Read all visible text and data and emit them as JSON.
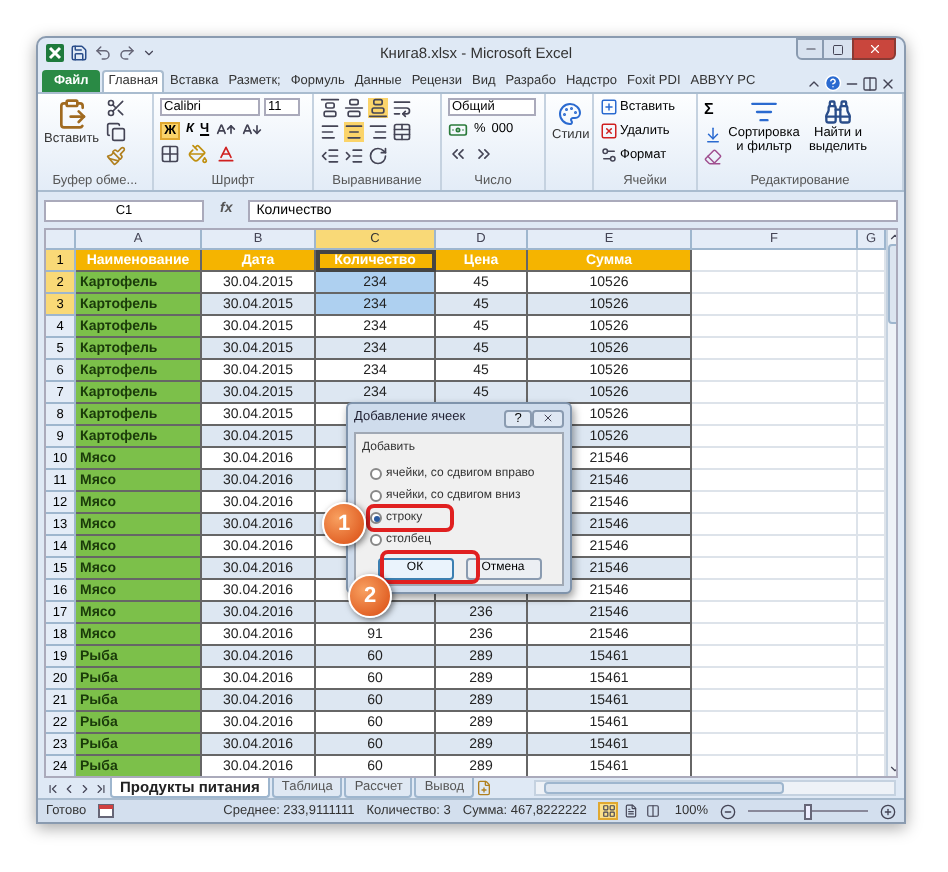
{
  "window": {
    "title": "Книга8.xlsx - Microsoft Excel"
  },
  "ribbon_tabs": [
    {
      "label": "Файл",
      "kind": "file",
      "selected": false
    },
    {
      "label": "Главная",
      "kind": "tab",
      "selected": true
    },
    {
      "label": "Вставка",
      "kind": "tab",
      "selected": false
    },
    {
      "label": "Разметк;",
      "kind": "tab",
      "selected": false
    },
    {
      "label": "Формуль",
      "kind": "tab",
      "selected": false
    },
    {
      "label": "Данные",
      "kind": "tab",
      "selected": false
    },
    {
      "label": "Рецензи",
      "kind": "tab",
      "selected": false
    },
    {
      "label": "Вид",
      "kind": "tab",
      "selected": false
    },
    {
      "label": "Разрабо",
      "kind": "tab",
      "selected": false
    },
    {
      "label": "Надстро",
      "kind": "tab",
      "selected": false
    },
    {
      "label": "Foxit PDI",
      "kind": "tab",
      "selected": false
    },
    {
      "label": "ABBYY PC",
      "kind": "tab",
      "selected": false
    }
  ],
  "ribbon": {
    "clipboard": {
      "paste": "Вставить",
      "label": "Буфер обме..."
    },
    "font": {
      "name": "Calibri",
      "size": "11",
      "bold": "Ж",
      "italic": "К",
      "underline": "Ч",
      "label": "Шрифт"
    },
    "alignment": {
      "label": "Выравнивание"
    },
    "number": {
      "format": "Общий",
      "percent": "%",
      "thousands": "000",
      "label": "Число"
    },
    "styles": {
      "button": "Стили"
    },
    "cells": {
      "insert": "Вставить",
      "delete": "Удалить",
      "format": "Формат",
      "label": "Ячейки"
    },
    "editing": {
      "sum": "Σ",
      "sort": "Сортировка и фильтр",
      "find": "Найти и выделить",
      "label": "Редактирование"
    }
  },
  "formula_bar": {
    "name_box": "C1",
    "fx": "fx",
    "value": "Количество"
  },
  "columns": [
    {
      "label": "A",
      "selected": false
    },
    {
      "label": "B",
      "selected": false
    },
    {
      "label": "C",
      "selected": true
    },
    {
      "label": "D",
      "selected": false
    },
    {
      "label": "E",
      "selected": false
    },
    {
      "label": "F",
      "selected": false
    },
    {
      "label": "G",
      "selected": false
    }
  ],
  "rows": [
    {
      "number": "1",
      "kind": "header",
      "selected": true,
      "cells": [
        "Наименование",
        "Дата",
        "Количество",
        "Цена",
        "Сумма"
      ]
    },
    {
      "number": "2",
      "kind": "data",
      "selected": true,
      "cells": [
        "Картофель",
        "30.04.2015",
        "234",
        "45",
        "10526"
      ]
    },
    {
      "number": "3",
      "kind": "data",
      "selected": true,
      "cells": [
        "Картофель",
        "30.04.2015",
        "234",
        "45",
        "10526"
      ]
    },
    {
      "number": "4",
      "kind": "data",
      "selected": false,
      "cells": [
        "Картофель",
        "30.04.2015",
        "234",
        "45",
        "10526"
      ]
    },
    {
      "number": "5",
      "kind": "data",
      "selected": false,
      "cells": [
        "Картофель",
        "30.04.2015",
        "234",
        "45",
        "10526"
      ]
    },
    {
      "number": "6",
      "kind": "data",
      "selected": false,
      "cells": [
        "Картофель",
        "30.04.2015",
        "234",
        "45",
        "10526"
      ]
    },
    {
      "number": "7",
      "kind": "data",
      "selected": false,
      "cells": [
        "Картофель",
        "30.04.2015",
        "234",
        "45",
        "10526"
      ]
    },
    {
      "number": "8",
      "kind": "data",
      "selected": false,
      "cells": [
        "Картофель",
        "30.04.2015",
        null,
        null,
        "10526"
      ]
    },
    {
      "number": "9",
      "kind": "data",
      "selected": false,
      "cells": [
        "Картофель",
        "30.04.2015",
        null,
        null,
        "10526"
      ]
    },
    {
      "number": "10",
      "kind": "data",
      "selected": false,
      "cells": [
        "Мясо",
        "30.04.2016",
        null,
        null,
        "21546"
      ]
    },
    {
      "number": "11",
      "kind": "data",
      "selected": false,
      "cells": [
        "Мясо",
        "30.04.2016",
        null,
        null,
        "21546"
      ]
    },
    {
      "number": "12",
      "kind": "data",
      "selected": false,
      "cells": [
        "Мясо",
        "30.04.2016",
        null,
        null,
        "21546"
      ]
    },
    {
      "number": "13",
      "kind": "data",
      "selected": false,
      "cells": [
        "Мясо",
        "30.04.2016",
        null,
        null,
        "21546"
      ]
    },
    {
      "number": "14",
      "kind": "data",
      "selected": false,
      "cells": [
        "Мясо",
        "30.04.2016",
        null,
        null,
        "21546"
      ]
    },
    {
      "number": "15",
      "kind": "data",
      "selected": false,
      "cells": [
        "Мясо",
        "30.04.2016",
        null,
        null,
        "21546"
      ]
    },
    {
      "number": "16",
      "kind": "data",
      "selected": false,
      "cells": [
        "Мясо",
        "30.04.2016",
        null,
        null,
        "21546"
      ]
    },
    {
      "number": "17",
      "kind": "data",
      "selected": false,
      "cells": [
        "Мясо",
        "30.04.2016",
        null,
        "236",
        "21546"
      ]
    },
    {
      "number": "18",
      "kind": "data",
      "selected": false,
      "cells": [
        "Мясо",
        "30.04.2016",
        "91",
        "236",
        "21546"
      ]
    },
    {
      "number": "19",
      "kind": "data",
      "selected": false,
      "cells": [
        "Рыба",
        "30.04.2016",
        "60",
        "289",
        "15461"
      ]
    },
    {
      "number": "20",
      "kind": "data",
      "selected": false,
      "cells": [
        "Рыба",
        "30.04.2016",
        "60",
        "289",
        "15461"
      ]
    },
    {
      "number": "21",
      "kind": "data",
      "selected": false,
      "cells": [
        "Рыба",
        "30.04.2016",
        "60",
        "289",
        "15461"
      ]
    },
    {
      "number": "22",
      "kind": "data",
      "selected": false,
      "cells": [
        "Рыба",
        "30.04.2016",
        "60",
        "289",
        "15461"
      ]
    },
    {
      "number": "23",
      "kind": "data",
      "selected": false,
      "cells": [
        "Рыба",
        "30.04.2016",
        "60",
        "289",
        "15461"
      ]
    },
    {
      "number": "24",
      "kind": "data",
      "selected": false,
      "cells": [
        "Рыба",
        "30.04.2016",
        "60",
        "289",
        "15461"
      ]
    }
  ],
  "dialog": {
    "title": "Добавление ячеек",
    "help": "?",
    "group": "Добавить",
    "options": [
      {
        "label": "ячейки, со сдвигом вправо",
        "selected": false
      },
      {
        "label": "ячейки, со сдвигом вниз",
        "selected": false
      },
      {
        "label": "строку",
        "selected": true
      },
      {
        "label": "столбец",
        "selected": false
      }
    ],
    "ok": "ОК",
    "cancel": "Отмена"
  },
  "callouts": [
    {
      "number": "1"
    },
    {
      "number": "2"
    }
  ],
  "sheet_tabs": [
    {
      "label": "Продукты питания",
      "selected": true
    },
    {
      "label": "Таблица",
      "selected": false
    },
    {
      "label": "Рассчет",
      "selected": false
    },
    {
      "label": "Вывод",
      "selected": false
    }
  ],
  "status_bar": {
    "ready": "Готово",
    "average": "Среднее: 233,9111111",
    "count": "Количество: 3",
    "sum": "Сумма: 467,8222222",
    "views": [
      {
        "selected": true
      },
      {
        "selected": false
      },
      {
        "selected": false
      }
    ],
    "zoom": "100%",
    "zoom_slider": {
      "level": 0.5
    }
  }
}
